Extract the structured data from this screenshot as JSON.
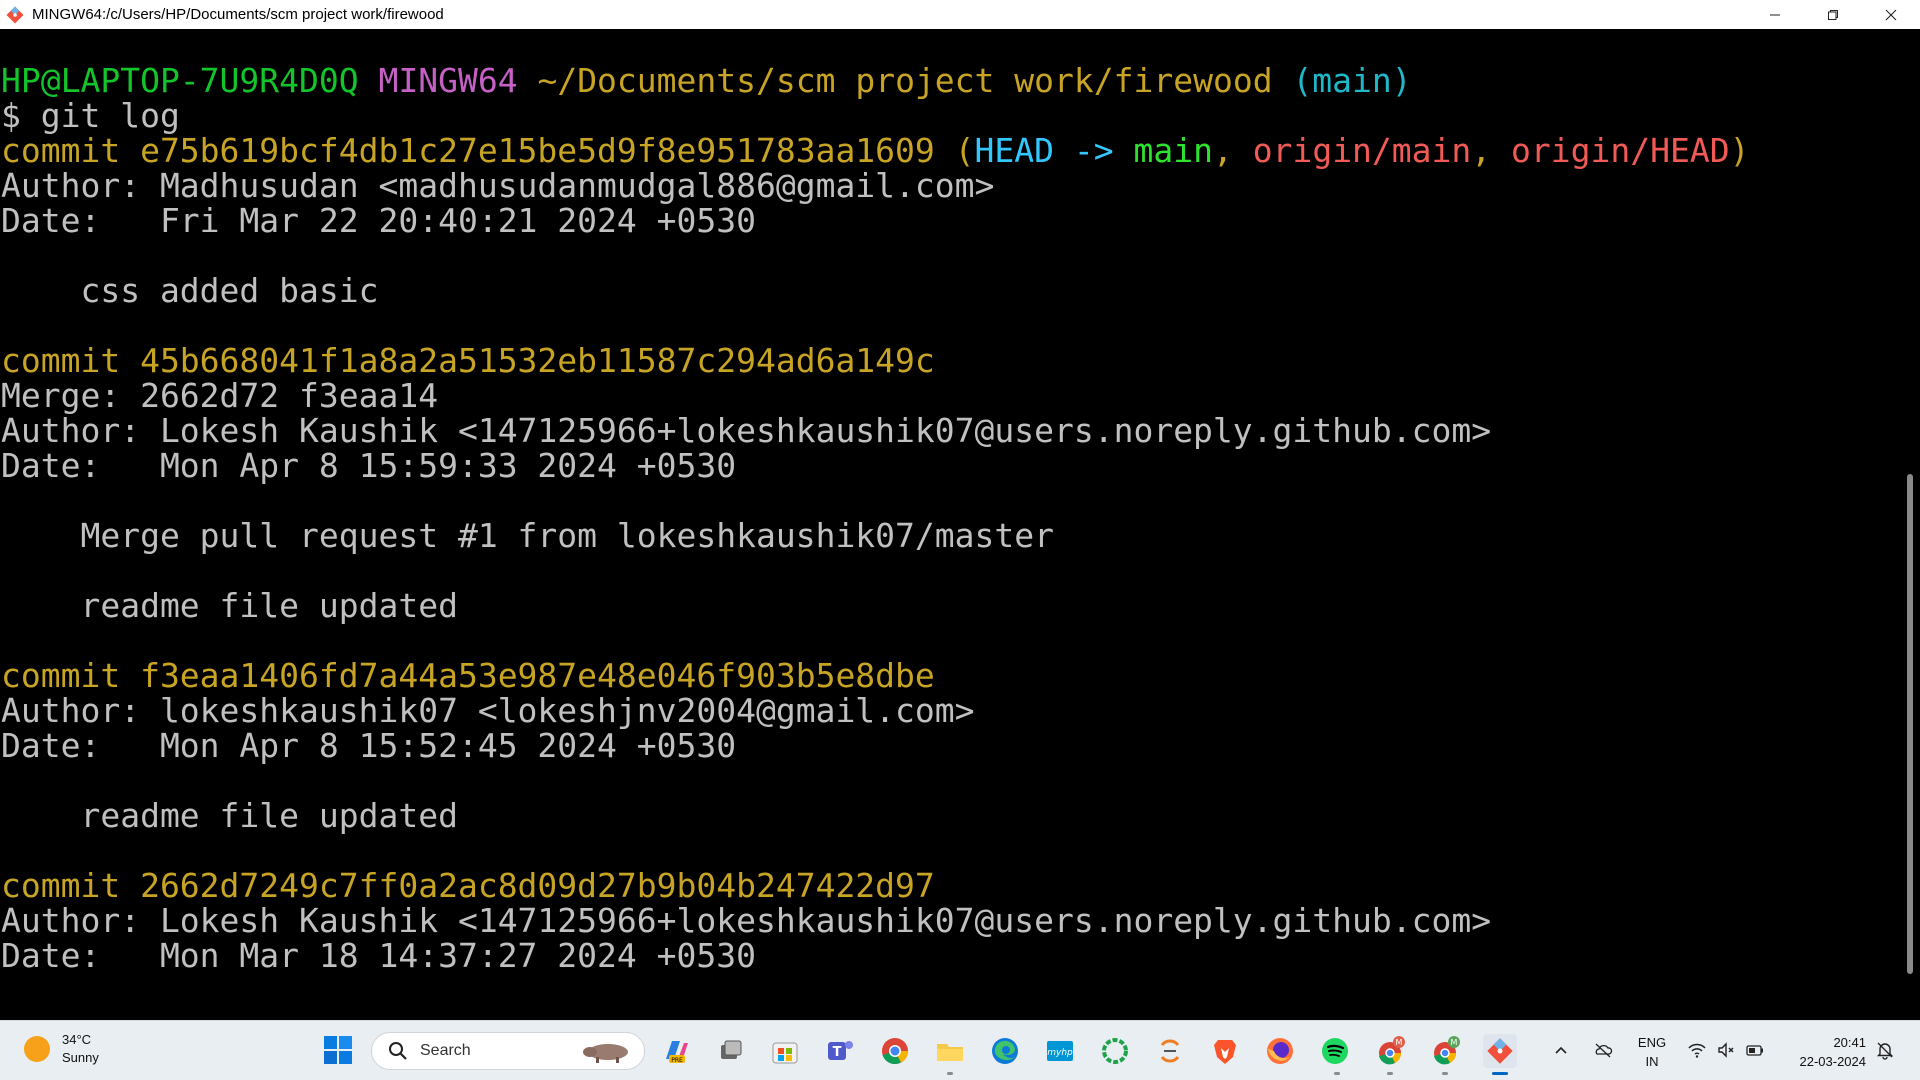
{
  "window": {
    "title": "MINGW64:/c/Users/HP/Documents/scm project work/firewood",
    "controls": [
      "minimize",
      "restore",
      "close"
    ]
  },
  "terminal": {
    "lines": [
      [
        {
          "t": "HP@LAPTOP-7U9R4D0Q ",
          "cls": "g"
        },
        {
          "t": "MINGW64 ",
          "cls": "m"
        },
        {
          "t": "~/Documents/scm project work/firewood ",
          "cls": "y"
        },
        {
          "t": "(main)",
          "cls": "c"
        }
      ],
      [
        {
          "t": "$ git log",
          "cls": "w"
        }
      ],
      [
        {
          "t": "commit e75b619bcf4db1c27e15be5d9f8e951783aa1609 ",
          "cls": "y"
        },
        {
          "t": "(",
          "cls": "y"
        },
        {
          "t": "HEAD -> ",
          "cls": "hd"
        },
        {
          "t": "main",
          "cls": "bg"
        },
        {
          "t": ", ",
          "cls": "y"
        },
        {
          "t": "origin/main",
          "cls": "r"
        },
        {
          "t": ", ",
          "cls": "y"
        },
        {
          "t": "origin/HEAD",
          "cls": "r"
        },
        {
          "t": ")",
          "cls": "y"
        }
      ],
      [
        {
          "t": "Author: Madhusudan <madhusudanmudgal886@gmail.com>",
          "cls": "w"
        }
      ],
      [
        {
          "t": "Date:   Fri Mar 22 20:40:21 2024 +0530",
          "cls": "w"
        }
      ],
      [
        {
          "t": "",
          "cls": "w"
        }
      ],
      [
        {
          "t": "    css added basic",
          "cls": "w"
        }
      ],
      [
        {
          "t": "",
          "cls": "w"
        }
      ],
      [
        {
          "t": "commit 45b668041f1a8a2a51532eb11587c294ad6a149c",
          "cls": "y"
        }
      ],
      [
        {
          "t": "Merge: 2662d72 f3eaa14",
          "cls": "w"
        }
      ],
      [
        {
          "t": "Author: Lokesh Kaushik <147125966+lokeshkaushik07@users.noreply.github.com>",
          "cls": "w"
        }
      ],
      [
        {
          "t": "Date:   Mon Apr 8 15:59:33 2024 +0530",
          "cls": "w"
        }
      ],
      [
        {
          "t": "",
          "cls": "w"
        }
      ],
      [
        {
          "t": "    Merge pull request #1 from lokeshkaushik07/master",
          "cls": "w"
        }
      ],
      [
        {
          "t": "",
          "cls": "w"
        }
      ],
      [
        {
          "t": "    readme file updated",
          "cls": "w"
        }
      ],
      [
        {
          "t": "",
          "cls": "w"
        }
      ],
      [
        {
          "t": "commit f3eaa1406fd7a44a53e987e48e046f903b5e8dbe",
          "cls": "y"
        }
      ],
      [
        {
          "t": "Author: lokeshkaushik07 <lokeshjnv2004@gmail.com>",
          "cls": "w"
        }
      ],
      [
        {
          "t": "Date:   Mon Apr 8 15:52:45 2024 +0530",
          "cls": "w"
        }
      ],
      [
        {
          "t": "",
          "cls": "w"
        }
      ],
      [
        {
          "t": "    readme file updated",
          "cls": "w"
        }
      ],
      [
        {
          "t": "",
          "cls": "w"
        }
      ],
      [
        {
          "t": "commit 2662d7249c7ff0a2ac8d09d27b9b04b247422d97",
          "cls": "y"
        }
      ],
      [
        {
          "t": "Author: Lokesh Kaushik <147125966+lokeshkaushik07@users.noreply.github.com>",
          "cls": "w"
        }
      ],
      [
        {
          "t": "Date:   Mon Mar 18 14:37:27 2024 +0530",
          "cls": "w"
        }
      ]
    ]
  },
  "taskbar": {
    "weather": {
      "temp": "34°C",
      "condition": "Sunny"
    },
    "search_placeholder": "Search",
    "apps": [
      {
        "name": "copilot-icon"
      },
      {
        "name": "task-view-icon"
      },
      {
        "name": "microsoft-store-icon"
      },
      {
        "name": "teams-icon"
      },
      {
        "name": "chrome-icon"
      },
      {
        "name": "file-explorer-icon"
      },
      {
        "name": "edge-icon"
      },
      {
        "name": "myhp-icon"
      },
      {
        "name": "loading-ring-icon"
      },
      {
        "name": "app-orange-icon"
      },
      {
        "name": "brave-icon"
      },
      {
        "name": "firefox-icon"
      },
      {
        "name": "spotify-icon"
      },
      {
        "name": "chrome-profile-m-icon"
      },
      {
        "name": "chrome-profile-m2-icon"
      },
      {
        "name": "git-bash-icon"
      }
    ],
    "tray": {
      "language_line1": "ENG",
      "language_line2": "IN",
      "time": "20:41",
      "date": "22-03-2024"
    }
  },
  "colors": {
    "prompt_user": "#13c42a",
    "prompt_mingw": "#c561c5",
    "path_yellow": "#c8a425",
    "branch_cyan": "#1fb8c8",
    "head_blue": "#32c8ff",
    "branch_green": "#2ee32e",
    "remote_red": "#f25a55",
    "text": "#c0c0c0",
    "taskbar_bg": "#e9eef3"
  }
}
